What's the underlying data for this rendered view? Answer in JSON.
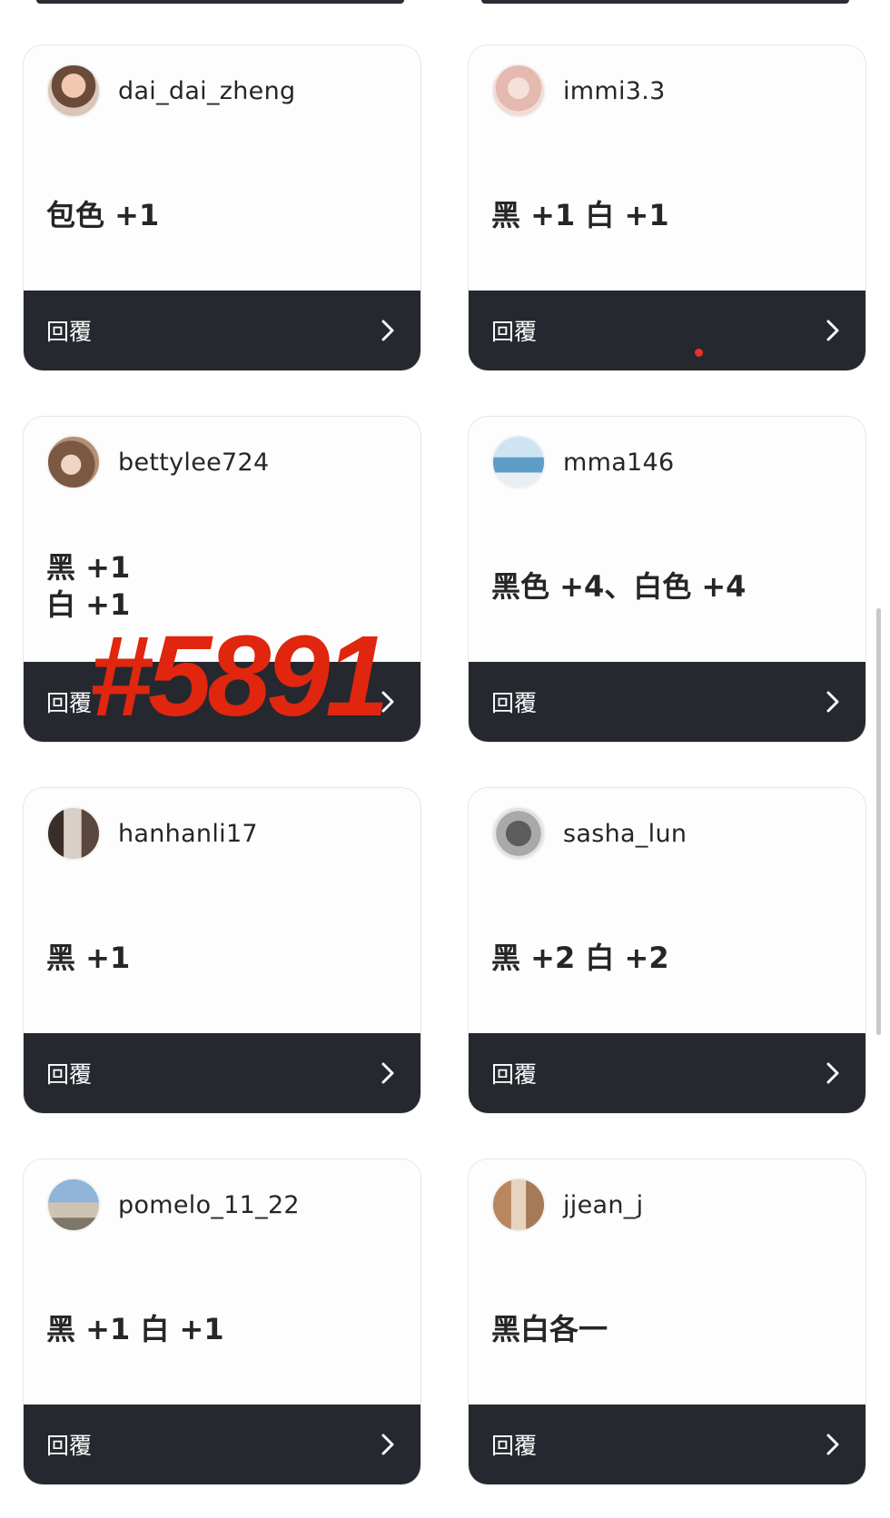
{
  "comments": [
    {
      "username": "dai_dai_zheng",
      "text": "包色 +1",
      "avatar_color": "#c89a7e"
    },
    {
      "username": "immi3.3",
      "text": "黑 +1 白 +1",
      "avatar_color": "#e9cfc8"
    },
    {
      "username": "bettylee724",
      "text": "黑 +1\n白 +1",
      "avatar_color": "#8a6a52"
    },
    {
      "username": "mma146",
      "text": "黑色 +4、白色 +4",
      "avatar_color": "#7fb2d6"
    },
    {
      "username": "hanhanli17",
      "text": "黑 +1",
      "avatar_color": "#6e5a4f"
    },
    {
      "username": "sasha_lun",
      "text": "黑 +2 白 +2",
      "avatar_color": "#8c8c8c"
    },
    {
      "username": "pomelo_11_22",
      "text": "黑 +1 白 +1",
      "avatar_color": "#7f97b3"
    },
    {
      "username": "jjean_j",
      "text": "黑白各一",
      "avatar_color": "#c9a48a"
    }
  ],
  "reply_label": "回覆",
  "watermark": "#5891",
  "colors": {
    "reply_bar": "#25282e",
    "watermark": "#e0260f",
    "notification_dot": "#e53325"
  }
}
